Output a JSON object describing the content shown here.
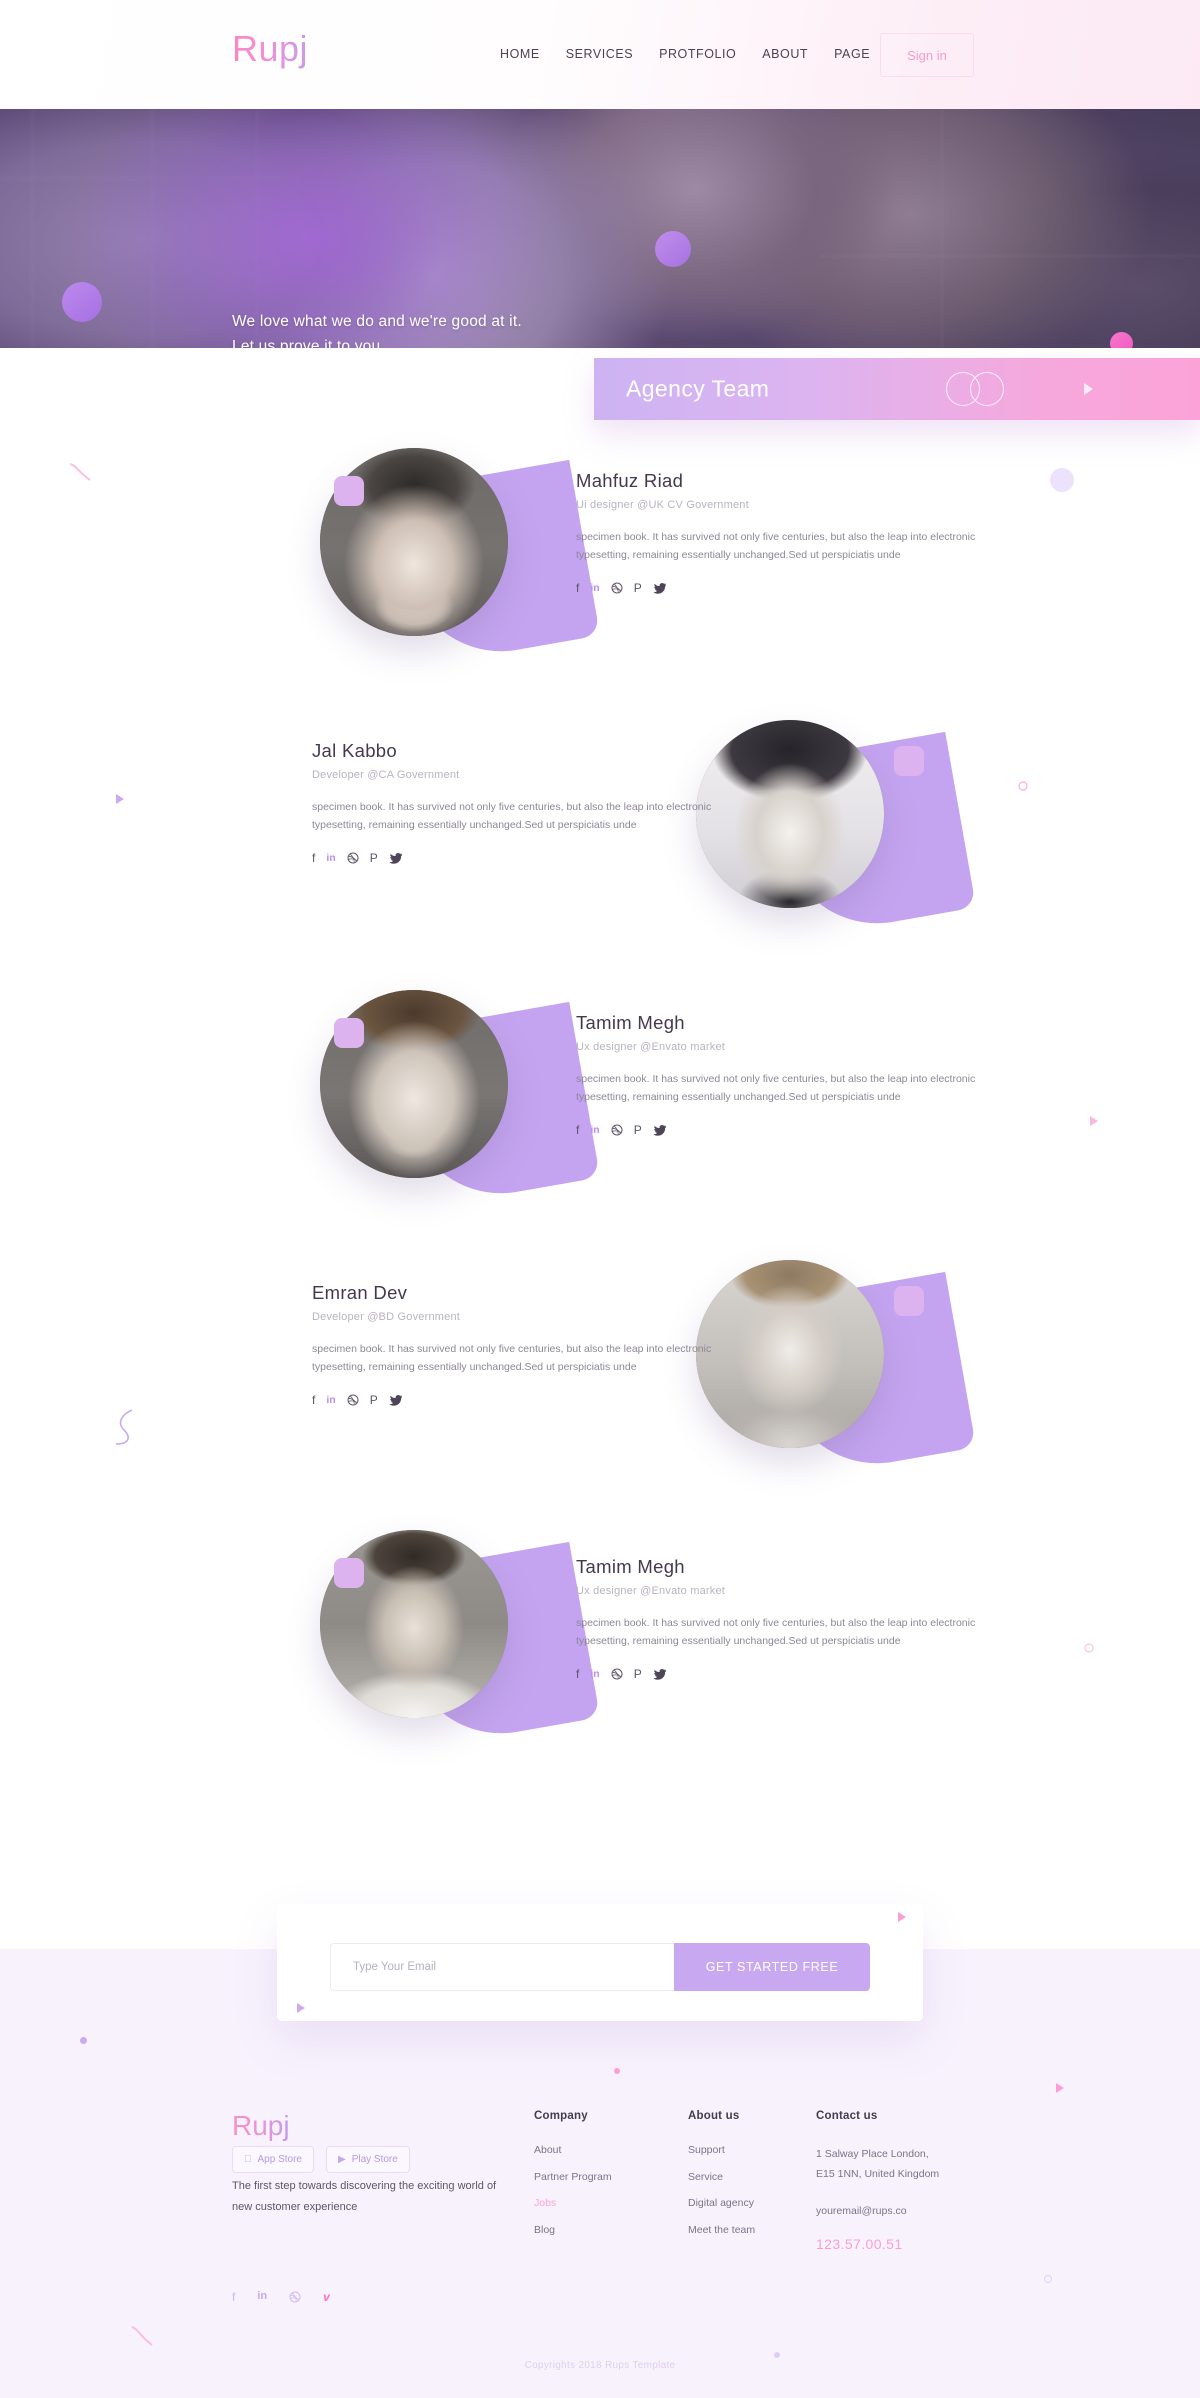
{
  "brand": {
    "logo": "Rupj",
    "logo_color_start": "#fc85c0",
    "logo_color_end": "#c79ceb"
  },
  "header": {
    "nav": [
      {
        "label": "HOME"
      },
      {
        "label": "SERVICES"
      },
      {
        "label": "PROTFOLIO"
      },
      {
        "label": "ABOUT"
      },
      {
        "label": "PAGE"
      }
    ],
    "signin_label": "Sign in"
  },
  "hero": {
    "line1": "We love what we do and we're good at it.",
    "line2": "Let us prove it to you."
  },
  "banner": {
    "title": "Agency Team",
    "circles_icon": "two-overlapping-circles-icon",
    "play_icon": "play-triangle-icon",
    "gradient_start": "#cdb3f2",
    "gradient_end": "#fba3d9"
  },
  "team": {
    "social_icons": [
      "facebook-icon",
      "linkedin-icon",
      "dribbble-icon",
      "pinterest-icon",
      "twitter-icon"
    ],
    "members": [
      {
        "name": "Mahfuz Riad",
        "role": "Ui designer @UK CV Government",
        "desc": "specimen book. It has survived not only five centuries, but also the leap into electronic typesetting, remaining essentially unchanged.Sed ut perspiciatis unde",
        "image_side": "left"
      },
      {
        "name": "Jal Kabbo",
        "role": "Developer @CA Government",
        "desc": "specimen book. It has survived not only five centuries, but also the leap into electronic typesetting, remaining essentially unchanged.Sed ut perspiciatis unde",
        "image_side": "right"
      },
      {
        "name": "Tamim Megh",
        "role": "Ux designer @Envato market",
        "desc": "specimen book. It has survived not only five centuries, but also the leap into electronic typesetting, remaining essentially unchanged.Sed ut perspiciatis unde",
        "image_side": "left"
      },
      {
        "name": "Emran Dev",
        "role": "Developer @BD Government",
        "desc": "specimen book. It has survived not only five centuries, but also the leap into electronic typesetting, remaining essentially unchanged.Sed ut perspiciatis unde",
        "image_side": "right"
      },
      {
        "name": "Tamim Megh",
        "role": "Ux designer @Envato market",
        "desc": "specimen book. It has survived not only five centuries, but also the leap into electronic typesetting, remaining essentially unchanged.Sed ut perspiciatis unde",
        "image_side": "left"
      }
    ]
  },
  "cta": {
    "email_placeholder": "Type Your Email",
    "email_value": "",
    "button_label": "GET STARTED FREE",
    "button_color": "#c9a8f2"
  },
  "footer": {
    "logo": "Rupj",
    "tagline": "The first step towards discovering the exciting world of new customer experience",
    "stores": [
      {
        "label": "App Store",
        "icon": "apple-icon"
      },
      {
        "label": "Play Store",
        "icon": "google-play-icon"
      }
    ],
    "socials": [
      "facebook-icon",
      "linkedin-icon",
      "dribbble-icon",
      "vimeo-icon"
    ],
    "columns": [
      {
        "title": "Company",
        "items": [
          {
            "label": "About",
            "highlight": false
          },
          {
            "label": "Partner Program",
            "highlight": false
          },
          {
            "label": "Jobs",
            "highlight": true
          },
          {
            "label": "Blog",
            "highlight": false
          }
        ]
      },
      {
        "title": "About us",
        "items": [
          {
            "label": "Support",
            "highlight": false
          },
          {
            "label": "Service",
            "highlight": false
          },
          {
            "label": "Digital agency",
            "highlight": false
          },
          {
            "label": "Meet the team",
            "highlight": false
          }
        ]
      }
    ],
    "contact": {
      "title": "Contact us",
      "address_line1": "1 Salway Place London,",
      "address_line2": "E15 1NN, United Kingdom",
      "email": "youremail@rups.co",
      "phone": "123.57.00.51",
      "phone_color": "#fb9ed3"
    },
    "copyright": "Copyrights 2018 Rups Template"
  }
}
